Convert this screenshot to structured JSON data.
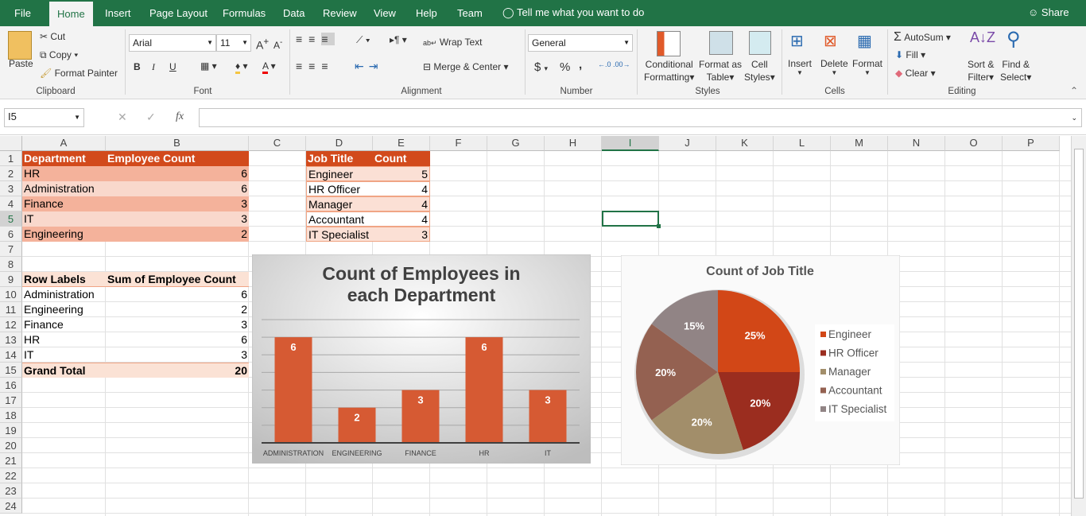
{
  "menu": {
    "tabs": [
      "File",
      "Home",
      "Insert",
      "Page Layout",
      "Formulas",
      "Data",
      "Review",
      "View",
      "Help",
      "Team"
    ],
    "active": "Home",
    "tell_me": "Tell me what you want to do",
    "share": "Share"
  },
  "ribbon": {
    "clipboard": {
      "paste": "Paste",
      "cut": "Cut",
      "copy": "Copy",
      "format_painter": "Format Painter",
      "label": "Clipboard"
    },
    "font": {
      "name": "Arial",
      "size": "11",
      "bold": "B",
      "italic": "I",
      "underline": "U",
      "label": "Font"
    },
    "alignment": {
      "wrap_text": "Wrap Text",
      "merge_center": "Merge & Center",
      "label": "Alignment"
    },
    "number": {
      "format": "General",
      "currency": "$",
      "percent": "%",
      "comma": ",",
      "label": "Number"
    },
    "styles": {
      "conditional": [
        "Conditional",
        "Formatting"
      ],
      "format_table": [
        "Format as",
        "Table"
      ],
      "cell_styles": [
        "Cell",
        "Styles"
      ],
      "label": "Styles"
    },
    "cells": {
      "insert": "Insert",
      "delete": "Delete",
      "format": "Format",
      "label": "Cells"
    },
    "editing": {
      "autosum": "AutoSum",
      "fill": "Fill",
      "clear": "Clear",
      "sort": [
        "Sort &",
        "Filter"
      ],
      "find": [
        "Find &",
        "Select"
      ],
      "label": "Editing"
    }
  },
  "formula_bar": {
    "name_box": "I5",
    "fx": "fx",
    "value": ""
  },
  "sheet": {
    "columns": [
      "A",
      "B",
      "C",
      "D",
      "E",
      "F",
      "G",
      "H",
      "I",
      "J",
      "K",
      "L",
      "M",
      "N",
      "O",
      "P"
    ],
    "selected_cell": "I5",
    "dept_table": {
      "headers": [
        "Department",
        "Employee Count"
      ],
      "rows": [
        [
          "HR",
          6
        ],
        [
          "Administration",
          6
        ],
        [
          "Finance",
          3
        ],
        [
          "IT",
          3
        ],
        [
          "Engineering",
          2
        ]
      ]
    },
    "job_table": {
      "headers": [
        "Job Title",
        "Count"
      ],
      "rows": [
        [
          "Engineer",
          5
        ],
        [
          "HR Officer",
          4
        ],
        [
          "Manager",
          4
        ],
        [
          "Accountant",
          4
        ],
        [
          "IT Specialist",
          3
        ]
      ]
    },
    "pivot": {
      "headers": [
        "Row Labels",
        "Sum of Employee Count"
      ],
      "rows": [
        [
          "Administration",
          6
        ],
        [
          "Engineering",
          2
        ],
        [
          "Finance",
          3
        ],
        [
          "HR",
          6
        ],
        [
          "IT",
          3
        ]
      ],
      "total": [
        "Grand Total",
        20
      ]
    }
  },
  "colors": {
    "accent": "#217346",
    "table_header": "#d24a1c",
    "band_dark": "#f4b29b",
    "band_light": "#f9d8cc"
  },
  "chart_data": [
    {
      "type": "bar",
      "title": "Count of Employees in each Department",
      "categories": [
        "ADMINISTRATION",
        "ENGINEERING",
        "FINANCE",
        "HR",
        "IT"
      ],
      "values": [
        6,
        2,
        3,
        6,
        3
      ],
      "ylim": [
        0,
        7
      ],
      "grid": true,
      "color": "#d65a33"
    },
    {
      "type": "pie",
      "title": "Count of Job Title",
      "categories": [
        "Engineer",
        "HR Officer",
        "Manager",
        "Accountant",
        "IT Specialist"
      ],
      "values": [
        5,
        4,
        4,
        4,
        3
      ],
      "labels": [
        "25%",
        "20%",
        "20%",
        "20%",
        "15%"
      ],
      "colors": [
        "#d24717",
        "#9b2d1f",
        "#a28e6a",
        "#946151",
        "#918485"
      ],
      "legend": "right"
    }
  ]
}
